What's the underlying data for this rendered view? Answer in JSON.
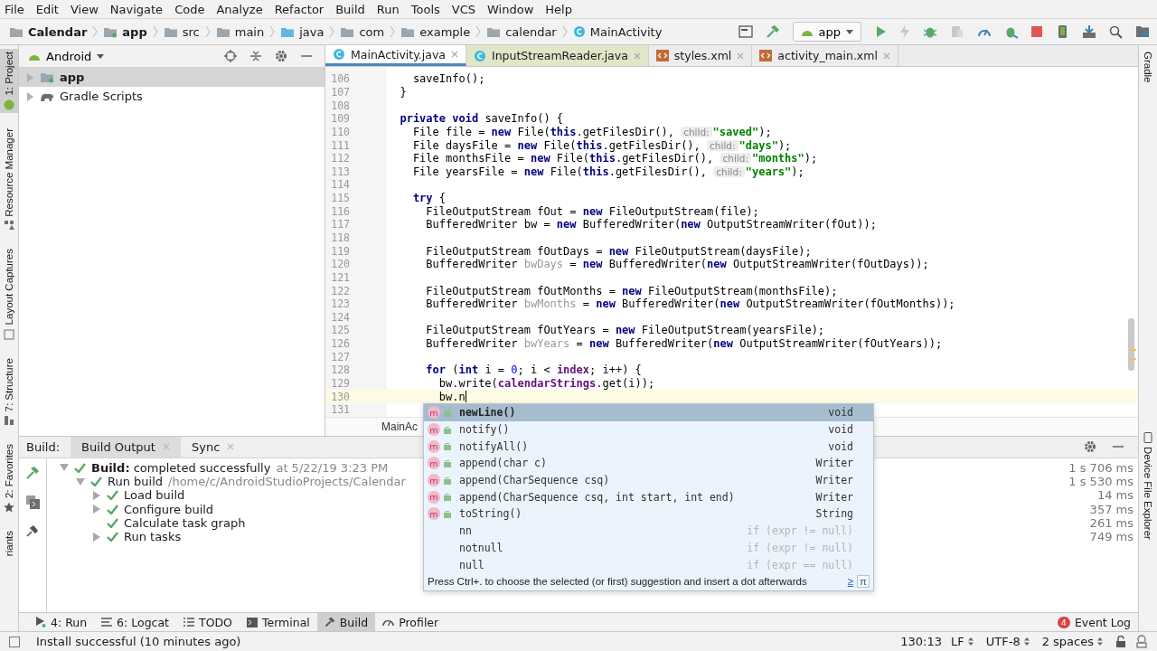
{
  "menu": [
    "File",
    "Edit",
    "View",
    "Navigate",
    "Code",
    "Analyze",
    "Refactor",
    "Build",
    "Run",
    "Tools",
    "VCS",
    "Window",
    "Help"
  ],
  "breadcrumbs": [
    {
      "label": "Calendar",
      "kind": "project"
    },
    {
      "label": "app",
      "kind": "module"
    },
    {
      "label": "src",
      "kind": "folder"
    },
    {
      "label": "main",
      "kind": "folder"
    },
    {
      "label": "java",
      "kind": "source"
    },
    {
      "label": "com",
      "kind": "folder"
    },
    {
      "label": "example",
      "kind": "folder"
    },
    {
      "label": "calendar",
      "kind": "folder"
    },
    {
      "label": "MainActivity",
      "kind": "class"
    }
  ],
  "run_config": "app",
  "left_stripe": [
    {
      "label": "1: Project",
      "kind": "project",
      "selected": true
    },
    {
      "label": "Resource Manager",
      "kind": "resource",
      "selected": false
    },
    {
      "label": "Layout Captures",
      "kind": "layout",
      "selected": false
    },
    {
      "label": "7: Structure",
      "kind": "structure",
      "selected": false
    },
    {
      "label": "2: Favorites",
      "kind": "favorites",
      "selected": false
    },
    {
      "label": "riants",
      "kind": "variants",
      "selected": false
    }
  ],
  "right_stripe": [
    {
      "label": "Gradle",
      "kind": "gradle"
    },
    {
      "label": "Device File Explorer",
      "kind": "device"
    }
  ],
  "project": {
    "view": "Android",
    "tree": [
      {
        "label": "app",
        "kind": "module",
        "selected": true,
        "expanded": false
      },
      {
        "label": "Gradle Scripts",
        "kind": "gradle",
        "selected": false,
        "expanded": false
      }
    ]
  },
  "editor_tabs": [
    {
      "label": "MainActivity.java",
      "kind": "java",
      "selected": true
    },
    {
      "label": "InputStreamReader.java",
      "kind": "library",
      "selected": false
    },
    {
      "label": "styles.xml",
      "kind": "xml",
      "selected": false
    },
    {
      "label": "activity_main.xml",
      "kind": "xml",
      "selected": false
    }
  ],
  "code": [
    {
      "n": "106",
      "tokens": [
        {
          "t": "    saveInfo();",
          "kind": "plain"
        }
      ]
    },
    {
      "n": "107",
      "tokens": [
        {
          "t": "  }",
          "kind": "plain"
        }
      ]
    },
    {
      "n": "108"
    },
    {
      "n": "109",
      "tokens": [
        {
          "t": "  private void",
          "kind": "keyword"
        },
        {
          "t": " saveInfo() {",
          "kind": "plain"
        }
      ]
    },
    {
      "n": "110",
      "tokens": [
        {
          "t": "    File file = ",
          "kind": "plain"
        },
        {
          "t": "new",
          "kind": "keyword"
        },
        {
          "t": " File(",
          "kind": "plain"
        },
        {
          "t": "this",
          "kind": "keyword"
        },
        {
          "t": ".getFilesDir(), ",
          "kind": "plain"
        },
        {
          "t": "child:",
          "kind": "hint"
        },
        {
          "t": "\"saved\"",
          "kind": "string"
        },
        {
          "t": ");",
          "kind": "plain"
        }
      ]
    },
    {
      "n": "111",
      "tokens": [
        {
          "t": "    File daysFile = ",
          "kind": "plain"
        },
        {
          "t": "new",
          "kind": "keyword"
        },
        {
          "t": " File(",
          "kind": "plain"
        },
        {
          "t": "this",
          "kind": "keyword"
        },
        {
          "t": ".getFilesDir(), ",
          "kind": "plain"
        },
        {
          "t": "child:",
          "kind": "hint"
        },
        {
          "t": "\"days\"",
          "kind": "string"
        },
        {
          "t": ");",
          "kind": "plain"
        }
      ]
    },
    {
      "n": "112",
      "tokens": [
        {
          "t": "    File monthsFile = ",
          "kind": "plain"
        },
        {
          "t": "new",
          "kind": "keyword"
        },
        {
          "t": " File(",
          "kind": "plain"
        },
        {
          "t": "this",
          "kind": "keyword"
        },
        {
          "t": ".getFilesDir(), ",
          "kind": "plain"
        },
        {
          "t": "child:",
          "kind": "hint"
        },
        {
          "t": "\"months\"",
          "kind": "string"
        },
        {
          "t": ");",
          "kind": "plain"
        }
      ]
    },
    {
      "n": "113",
      "tokens": [
        {
          "t": "    File yearsFile = ",
          "kind": "plain"
        },
        {
          "t": "new",
          "kind": "keyword"
        },
        {
          "t": " File(",
          "kind": "plain"
        },
        {
          "t": "this",
          "kind": "keyword"
        },
        {
          "t": ".getFilesDir(), ",
          "kind": "plain"
        },
        {
          "t": "child:",
          "kind": "hint"
        },
        {
          "t": "\"years\"",
          "kind": "string"
        },
        {
          "t": ");",
          "kind": "plain"
        }
      ]
    },
    {
      "n": "114"
    },
    {
      "n": "115",
      "tokens": [
        {
          "t": "    try",
          "kind": "keyword"
        },
        {
          "t": " {",
          "kind": "plain"
        }
      ]
    },
    {
      "n": "116",
      "tokens": [
        {
          "t": "      FileOutputStream fOut = ",
          "kind": "plain"
        },
        {
          "t": "new",
          "kind": "keyword"
        },
        {
          "t": " FileOutputStream(file);",
          "kind": "plain"
        }
      ]
    },
    {
      "n": "117",
      "tokens": [
        {
          "t": "      BufferedWriter bw = ",
          "kind": "plain"
        },
        {
          "t": "new",
          "kind": "keyword"
        },
        {
          "t": " BufferedWriter(",
          "kind": "plain"
        },
        {
          "t": "new",
          "kind": "keyword"
        },
        {
          "t": " OutputStreamWriter(fOut));",
          "kind": "plain"
        }
      ]
    },
    {
      "n": "118"
    },
    {
      "n": "119",
      "tokens": [
        {
          "t": "      FileOutputStream fOutDays = ",
          "kind": "plain"
        },
        {
          "t": "new",
          "kind": "keyword"
        },
        {
          "t": " FileOutputStream(daysFile);",
          "kind": "plain"
        }
      ]
    },
    {
      "n": "120",
      "tokens": [
        {
          "t": "      BufferedWriter ",
          "kind": "plain"
        },
        {
          "t": "bwDays",
          "kind": "unused"
        },
        {
          "t": " = ",
          "kind": "plain"
        },
        {
          "t": "new",
          "kind": "keyword"
        },
        {
          "t": " BufferedWriter(",
          "kind": "plain"
        },
        {
          "t": "new",
          "kind": "keyword"
        },
        {
          "t": " OutputStreamWriter(fOutDays));",
          "kind": "plain"
        }
      ]
    },
    {
      "n": "121"
    },
    {
      "n": "122",
      "tokens": [
        {
          "t": "      FileOutputStream fOutMonths = ",
          "kind": "plain"
        },
        {
          "t": "new",
          "kind": "keyword"
        },
        {
          "t": " FileOutputStream(monthsFile);",
          "kind": "plain"
        }
      ]
    },
    {
      "n": "123",
      "tokens": [
        {
          "t": "      BufferedWriter ",
          "kind": "plain"
        },
        {
          "t": "bwMonths",
          "kind": "unused"
        },
        {
          "t": " = ",
          "kind": "plain"
        },
        {
          "t": "new",
          "kind": "keyword"
        },
        {
          "t": " BufferedWriter(",
          "kind": "plain"
        },
        {
          "t": "new",
          "kind": "keyword"
        },
        {
          "t": " OutputStreamWriter(fOutMonths));",
          "kind": "plain"
        }
      ]
    },
    {
      "n": "124"
    },
    {
      "n": "125",
      "tokens": [
        {
          "t": "      FileOutputStream fOutYears = ",
          "kind": "plain"
        },
        {
          "t": "new",
          "kind": "keyword"
        },
        {
          "t": " FileOutputStream(yearsFile);",
          "kind": "plain"
        }
      ]
    },
    {
      "n": "126",
      "tokens": [
        {
          "t": "      BufferedWriter ",
          "kind": "plain"
        },
        {
          "t": "bwYears",
          "kind": "unused"
        },
        {
          "t": " = ",
          "kind": "plain"
        },
        {
          "t": "new",
          "kind": "keyword"
        },
        {
          "t": " BufferedWriter(",
          "kind": "plain"
        },
        {
          "t": "new",
          "kind": "keyword"
        },
        {
          "t": " OutputStreamWriter(fOutYears));",
          "kind": "plain"
        }
      ]
    },
    {
      "n": "127"
    },
    {
      "n": "128",
      "tokens": [
        {
          "t": "      for",
          "kind": "keyword"
        },
        {
          "t": " (",
          "kind": "plain"
        },
        {
          "t": "int",
          "kind": "keyword"
        },
        {
          "t": " i = ",
          "kind": "plain"
        },
        {
          "t": "0",
          "kind": "number"
        },
        {
          "t": "; i < ",
          "kind": "plain"
        },
        {
          "t": "index",
          "kind": "field"
        },
        {
          "t": "; i++) {",
          "kind": "plain"
        }
      ]
    },
    {
      "n": "129",
      "tokens": [
        {
          "t": "        bw.write(",
          "kind": "plain"
        },
        {
          "t": "calendarStrings",
          "kind": "field"
        },
        {
          "t": ".get(i));",
          "kind": "plain"
        }
      ]
    },
    {
      "n": "130",
      "current": true,
      "tokens": [
        {
          "t": "        bw.n",
          "kind": "plain"
        }
      ]
    },
    {
      "n": "131"
    }
  ],
  "editor_breadcrumb": "MainAc",
  "completion": {
    "items": [
      {
        "badge": "m",
        "name": "newLine()",
        "type": "void",
        "kind": "method",
        "selected": true
      },
      {
        "badge": "m",
        "name": "notify()",
        "type": "void",
        "kind": "method",
        "selected": false
      },
      {
        "badge": "m",
        "name": "notifyAll()",
        "type": "void",
        "kind": "method",
        "selected": false
      },
      {
        "badge": "m",
        "name": "append(char c)",
        "type": "Writer",
        "kind": "method",
        "selected": false
      },
      {
        "badge": "m",
        "name": "append(CharSequence csq)",
        "type": "Writer",
        "kind": "method",
        "selected": false
      },
      {
        "badge": "m",
        "name": "append(CharSequence csq, int start, int end)",
        "type": "Writer",
        "kind": "method",
        "selected": false
      },
      {
        "badge": "m",
        "name": "toString()",
        "type": "String",
        "kind": "method",
        "selected": false
      },
      {
        "name": "nn",
        "type": "if (expr != null)",
        "kind": "template",
        "selected": false
      },
      {
        "name": "notnull",
        "type": "if (expr != null)",
        "kind": "template",
        "selected": false
      },
      {
        "name": "null",
        "type": "if (expr == null)",
        "kind": "template",
        "selected": false
      }
    ],
    "hint": "Press Ctrl+. to choose the selected (or first) suggestion and insert a dot afterwards",
    "hint_link": "≥",
    "hint_pi": "π"
  },
  "build": {
    "title": "Build:",
    "tabs": [
      {
        "label": "Build Output",
        "selected": true
      },
      {
        "label": "Sync",
        "selected": false
      }
    ],
    "tree": [
      {
        "label": "**Build:** completed successfully",
        "detail": "at 5/22/19 3:23 PM",
        "time": "1 s 706 ms",
        "expanded": true,
        "children": [
          {
            "label": "Run build",
            "detail": "/home/c/AndroidStudioProjects/Calendar",
            "time": "1 s 530 ms",
            "expanded": true,
            "children": [
              {
                "label": "Load build",
                "time": "14 ms",
                "expanded": false
              },
              {
                "label": "Configure build",
                "time": "357 ms",
                "expanded": false
              },
              {
                "label": "Calculate task graph",
                "time": "261 ms"
              },
              {
                "label": "Run tasks",
                "time": "749 ms",
                "expanded": false
              }
            ]
          }
        ]
      }
    ]
  },
  "tool_tabs": [
    {
      "label": "4: Run",
      "kind": "run",
      "selected": false
    },
    {
      "label": "6: Logcat",
      "kind": "logcat",
      "selected": false
    },
    {
      "label": "TODO",
      "kind": "todo",
      "selected": false
    },
    {
      "label": "Terminal",
      "kind": "terminal",
      "selected": false
    },
    {
      "label": "Build",
      "kind": "build",
      "selected": true
    },
    {
      "label": "Profiler",
      "kind": "profiler",
      "selected": false
    }
  ],
  "event_log": {
    "label": "Event Log",
    "count": "4"
  },
  "status": {
    "message": "Install successful (10 minutes ago)",
    "position": "130:13",
    "line_sep": "LF",
    "encoding": "UTF-8",
    "indent": "2 spaces"
  }
}
